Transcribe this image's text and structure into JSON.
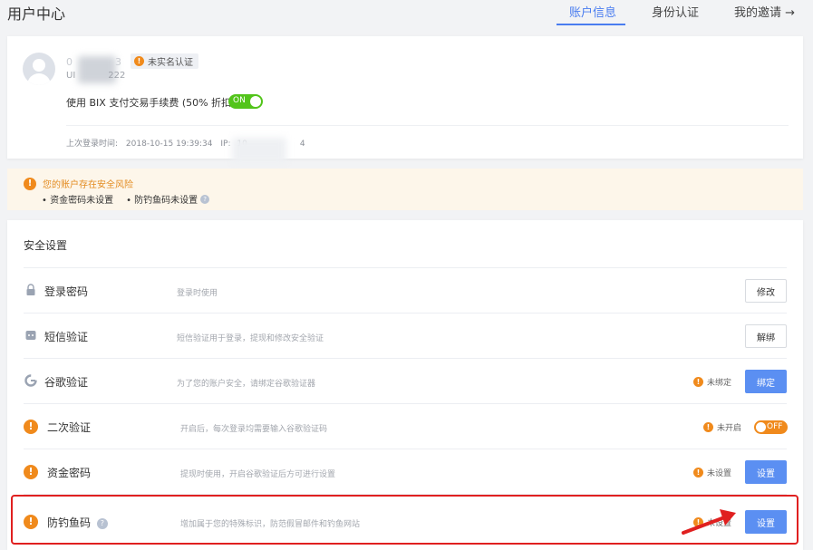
{
  "page": {
    "title": "用户中心"
  },
  "tabs": [
    {
      "label": "账户信息",
      "active": true
    },
    {
      "label": "身份认证",
      "active": false
    },
    {
      "label": "我的邀请 →",
      "active": false
    }
  ],
  "profile": {
    "name_partial": "0",
    "name_suffix": "3",
    "uid_prefix": "UI",
    "uid_suffix": "222",
    "verify_badge": "未实名认证",
    "fee_text": "使用 BIX 支付交易手续费 (50% 折扣)",
    "fee_toggle": "ON",
    "last_login_label": "上次登录时间:",
    "last_login_time": "2018-10-15 19:39:34",
    "ip_label": "IP:",
    "ip_prefix": "10",
    "ip_suffix": "4"
  },
  "alert": {
    "title": "您的账户存在安全风险",
    "items": [
      "资金密码未设置",
      "防钓鱼码未设置"
    ]
  },
  "security": {
    "title": "安全设置",
    "rows": [
      {
        "label": "登录密码",
        "desc": "登录时使用",
        "status": "",
        "action": "修改",
        "icon": "lock-icon"
      },
      {
        "label": "短信验证",
        "desc": "短信验证用于登录，提现和修改安全验证",
        "status": "",
        "action": "解绑",
        "icon": "message-icon"
      },
      {
        "label": "谷歌验证",
        "desc": "为了您的账户安全，请绑定谷歌验证器",
        "status": "未绑定",
        "action": "绑定",
        "icon": "google-icon"
      },
      {
        "label": "二次验证",
        "desc": "开启后，每次登录均需要输入谷歌验证码",
        "status": "未开启",
        "action": "OFF",
        "icon": "warning-icon"
      },
      {
        "label": "资金密码",
        "desc": "提现时使用，开启谷歌验证后方可进行设置",
        "status": "未设置",
        "action": "设置",
        "icon": "warning-icon"
      },
      {
        "label": "防钓鱼码",
        "desc": "增加属于您的特殊标识，防范假冒邮件和钓鱼网站",
        "status": "未设置",
        "action": "设置",
        "icon": "warning-icon"
      }
    ]
  },
  "colors": {
    "accent": "#4a7df0",
    "warning": "#f08a1c",
    "success": "#52c41a",
    "annotation": "#e02020"
  }
}
